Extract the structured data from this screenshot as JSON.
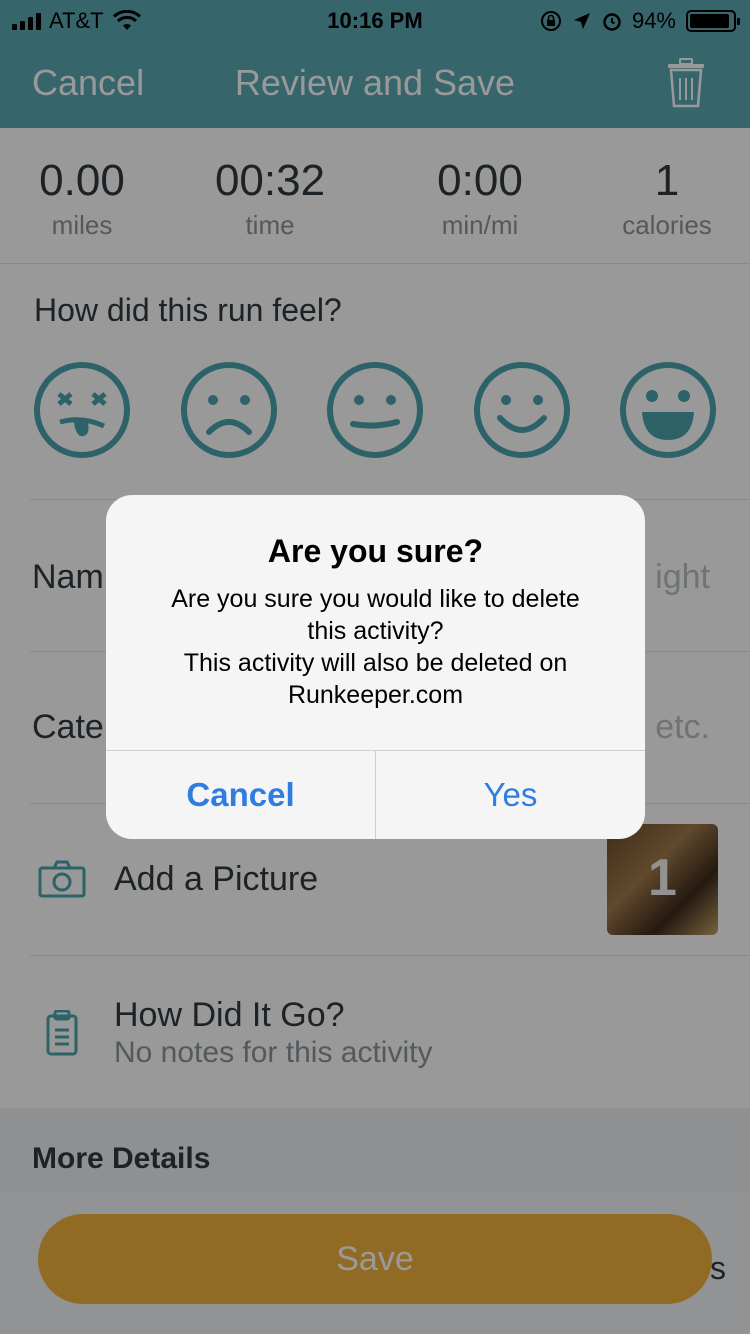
{
  "status_bar": {
    "carrier": "AT&T",
    "time": "10:16 PM",
    "battery": "94%",
    "battery_level": 0.94
  },
  "nav": {
    "cancel_label": "Cancel",
    "title": "Review and Save",
    "trash_icon": "trash-icon"
  },
  "stats": [
    {
      "value": "0.00",
      "label": "miles"
    },
    {
      "value": "00:32",
      "label": "time"
    },
    {
      "value": "0:00",
      "label": "min/mi"
    },
    {
      "value": "1",
      "label": "calories"
    }
  ],
  "feel": {
    "question": "How did this run feel?",
    "faces": [
      "dizzy-face-icon",
      "sad-face-icon",
      "neutral-face-icon",
      "smile-face-icon",
      "laugh-face-icon"
    ]
  },
  "name_row": {
    "label": "Nam",
    "placeholder": "ight"
  },
  "category_row": {
    "label": "Cate",
    "placeholder": "etc."
  },
  "picture_row": {
    "label": "Add a Picture",
    "photo_count": "1"
  },
  "notes_row": {
    "title": "How Did It Go?",
    "subtitle": "No notes for this activity"
  },
  "more_details": {
    "title": "More Details"
  },
  "save_button": {
    "label": "Save"
  },
  "behind_footer_text": "s",
  "alert": {
    "title": "Are you sure?",
    "message_lines": [
      "Are you sure you would like to delete",
      "this activity?",
      "This activity will also be deleted on",
      "Runkeeper.com"
    ],
    "cancel_label": "Cancel",
    "yes_label": "Yes"
  },
  "colors": {
    "header": "#5ba9b3",
    "accent_teal": "#4aa3ad",
    "save_button": "#f2b33d",
    "alert_button": "#2f7de1"
  }
}
